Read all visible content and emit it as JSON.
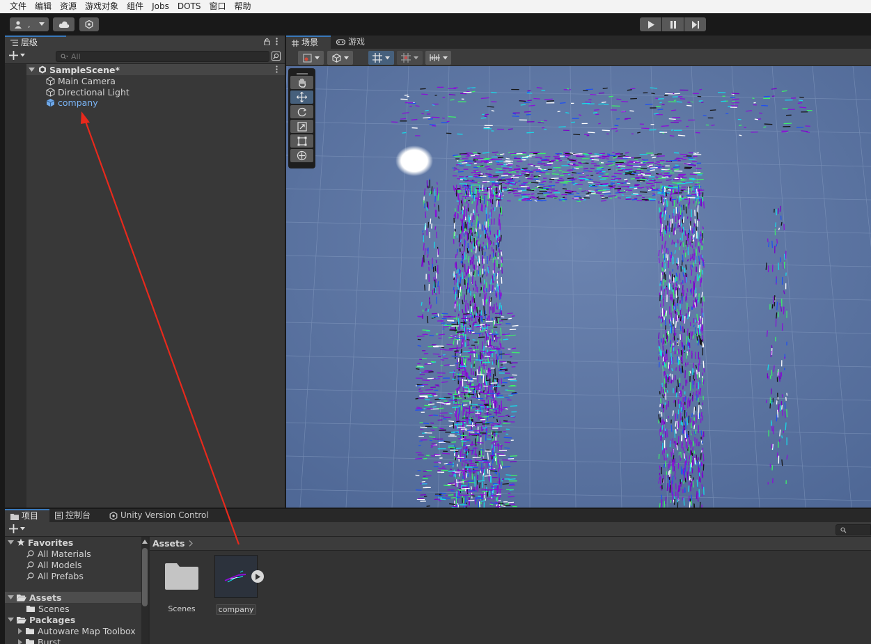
{
  "menubar": {
    "items": [
      "文件",
      "编辑",
      "资源",
      "游戏对象",
      "组件",
      "Jobs",
      "DOTS",
      "窗口",
      "帮助"
    ]
  },
  "toolbar": {
    "account_label": ",",
    "account_icon": "account-icon",
    "cloud_icon": "cloud-icon",
    "settings_icon": "services-icon",
    "play_icon": "play-icon",
    "pause_icon": "pause-icon",
    "step_icon": "step-icon"
  },
  "hierarchy": {
    "tab_label": "层级",
    "search_placeholder": "All",
    "scene_name": "SampleScene*",
    "items": [
      {
        "label": "Main Camera",
        "icon": "gameobject-icon"
      },
      {
        "label": "Directional Light",
        "icon": "gameobject-icon"
      },
      {
        "label": "company",
        "icon": "prefab-icon",
        "color": "#7ab4f5"
      }
    ]
  },
  "sceneview": {
    "tabs": [
      {
        "label": "场景",
        "icon": "grid-icon",
        "active": true
      },
      {
        "label": "游戏",
        "icon": "gamepad-icon",
        "active": false
      }
    ],
    "tools": [
      "view-hand-tool",
      "move-tool",
      "rotate-tool",
      "scale-tool",
      "rect-tool",
      "transform-tool"
    ],
    "active_tool": "move-tool"
  },
  "project": {
    "tabs": [
      {
        "label": "项目",
        "icon": "folder-icon",
        "active": true
      },
      {
        "label": "控制台",
        "icon": "console-icon",
        "active": false
      },
      {
        "label": "Unity Version Control",
        "icon": "version-control-icon",
        "active": false
      }
    ],
    "favorites": {
      "label": "Favorites",
      "items": [
        "All Materials",
        "All Models",
        "All Prefabs"
      ]
    },
    "assets_root": {
      "label": "Assets",
      "items": [
        "Scenes"
      ]
    },
    "packages": {
      "label": "Packages",
      "items": [
        "Autoware Map Toolbox",
        "Burst"
      ]
    },
    "breadcrumb": "Assets",
    "grid_items": [
      {
        "label": "Scenes",
        "type": "folder"
      },
      {
        "label": "company",
        "type": "model"
      }
    ]
  },
  "colors": {
    "accent": "#3a79bb",
    "arrow": "#e8291c",
    "viewport_bg": "#5e76a0",
    "point_purple": "#8a10d8",
    "point_cyan": "#18d8e8"
  }
}
